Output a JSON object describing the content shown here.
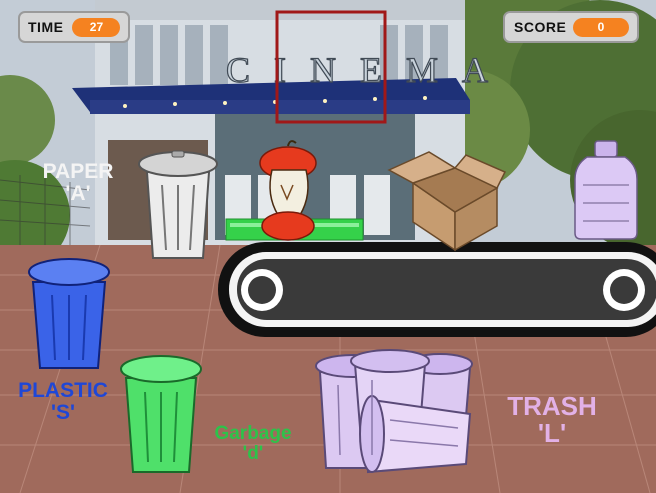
{
  "hud": {
    "time_label": "TIME",
    "time_value": "27",
    "score_label": "SCORE",
    "score_value": "0"
  },
  "background": {
    "sign_text": "CINEMA"
  },
  "bins": {
    "paper": {
      "name": "PAPER",
      "key": "'A'"
    },
    "plastic": {
      "name": "PLASTIC",
      "key": "'S'"
    },
    "garbage": {
      "name": "Garbage",
      "key": "'d'"
    },
    "trash": {
      "name": "TRASH",
      "key": "'L'"
    }
  },
  "colors": {
    "hud_value": "#f58220",
    "paper_label": "#f4f4f4",
    "plastic_label": "#1f47d6",
    "garbage_label": "#2ec24a",
    "trash_label": "#e2b1e6",
    "target_frame": "#a01818",
    "progress_bar": "#35d14a"
  },
  "items": [
    "apple-core",
    "cardboard-box",
    "plastic-bottle"
  ]
}
